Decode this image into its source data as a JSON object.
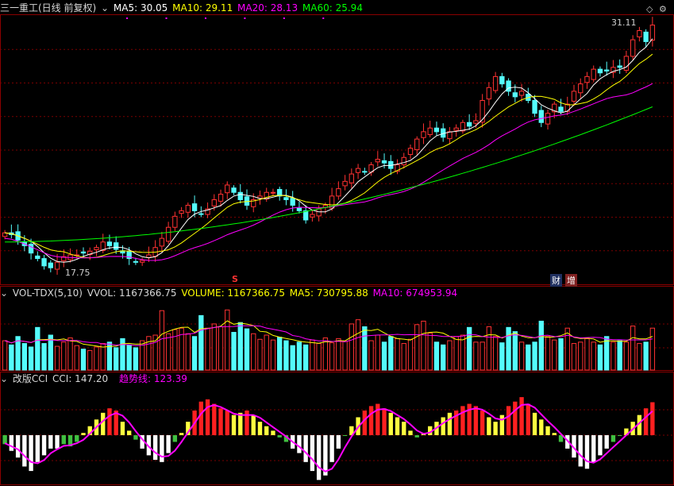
{
  "header": {
    "title": "三一重工(日线 前复权)",
    "ma5": "MA5: 30.05",
    "ma10": "MA10: 29.11",
    "ma20": "MA20: 28.13",
    "ma60": "MA60: 25.94"
  },
  "price_panel": {
    "high_label": "31.11",
    "low_label": "17.75",
    "markers": {
      "s": "S",
      "cai": "财",
      "zeng": "增"
    }
  },
  "volume_panel": {
    "name": "VOL-TDX(5,10)",
    "vvol": "VVOL: 1167366.75",
    "volume": "VOLUME: 1167366.75",
    "ma5": "MA5: 730795.88",
    "ma10": "MA10: 674953.94"
  },
  "cci_panel": {
    "name": "改版CCI",
    "cci": "CCI: 147.20",
    "trend": "趋势线: 123.39"
  },
  "colors": {
    "up": "#ff3232",
    "down": "#54fcfc",
    "grid": "#8b0000",
    "ma5": "#ffffff",
    "ma10": "#ffff00",
    "ma20": "#ff00ff",
    "ma60": "#00ff00"
  },
  "chart_data": [
    {
      "type": "candlestick",
      "title": "三一重工(日线 前复权)",
      "ylim": [
        17.0,
        31.6
      ],
      "close": [
        19.8,
        19.7,
        19.4,
        19.1,
        18.7,
        18.4,
        18.0,
        17.9,
        18.2,
        18.5,
        18.6,
        18.6,
        18.7,
        18.8,
        19.0,
        19.3,
        19.1,
        18.9,
        18.7,
        18.4,
        18.2,
        18.3,
        18.6,
        19.0,
        19.5,
        20.1,
        20.7,
        21.0,
        21.3,
        21.0,
        20.8,
        21.1,
        21.6,
        21.9,
        22.4,
        22.0,
        21.6,
        21.3,
        21.6,
        21.8,
        22.0,
        22.0,
        21.8,
        21.6,
        21.3,
        21.0,
        20.5,
        20.8,
        21.1,
        21.3,
        21.8,
        22.2,
        22.6,
        23.0,
        23.3,
        23.1,
        23.5,
        23.8,
        23.6,
        23.3,
        23.5,
        23.9,
        24.4,
        24.9,
        25.3,
        25.5,
        25.3,
        25.0,
        25.3,
        25.5,
        25.8,
        25.6,
        25.9,
        27.0,
        27.7,
        28.3,
        27.9,
        27.5,
        27.2,
        27.5,
        27.0,
        26.3,
        25.8,
        26.3,
        26.8,
        26.4,
        26.8,
        27.5,
        27.9,
        28.3,
        28.7,
        28.5,
        28.6,
        28.8,
        28.8,
        29.4,
        30.3,
        30.8,
        30.2,
        31.1
      ],
      "series": [
        {
          "name": "MA5",
          "last": 30.05
        },
        {
          "name": "MA10",
          "last": 29.11
        },
        {
          "name": "MA20",
          "last": 28.13
        },
        {
          "name": "MA60",
          "last": 25.94
        }
      ],
      "high_mark": 31.11,
      "low_mark": 17.75
    },
    {
      "type": "bar",
      "title": "VOL-TDX(5,10)",
      "values": [
        0.42,
        0.36,
        0.48,
        0.38,
        0.33,
        0.61,
        0.38,
        0.5,
        0.34,
        0.4,
        0.46,
        0.35,
        0.3,
        0.28,
        0.33,
        0.38,
        0.4,
        0.32,
        0.45,
        0.36,
        0.32,
        0.42,
        0.48,
        0.5,
        0.85,
        0.52,
        0.58,
        0.6,
        0.52,
        0.48,
        0.78,
        0.6,
        0.66,
        0.62,
        0.86,
        0.54,
        0.68,
        0.59,
        0.52,
        0.44,
        0.5,
        0.43,
        0.47,
        0.42,
        0.35,
        0.4,
        0.36,
        0.43,
        0.38,
        0.46,
        0.39,
        0.45,
        0.41,
        0.66,
        0.72,
        0.62,
        0.42,
        0.5,
        0.4,
        0.48,
        0.45,
        0.38,
        0.44,
        0.65,
        0.7,
        0.53,
        0.4,
        0.36,
        0.42,
        0.48,
        0.5,
        0.61,
        0.4,
        0.4,
        0.62,
        0.48,
        0.39,
        0.61,
        0.55,
        0.4,
        0.36,
        0.4,
        0.7,
        0.48,
        0.43,
        0.45,
        0.6,
        0.38,
        0.4,
        0.45,
        0.4,
        0.36,
        0.48,
        0.4,
        0.42,
        0.4,
        0.63,
        0.38,
        0.4,
        0.6
      ],
      "series": [
        {
          "name": "VOLUME",
          "last": 1167366.75
        },
        {
          "name": "MA5",
          "last": 730795.88
        },
        {
          "name": "MA10",
          "last": 674953.94
        }
      ]
    },
    {
      "type": "bar",
      "title": "改版CCI",
      "ylim": [
        -220,
        220
      ],
      "values": [
        -40,
        -70,
        -100,
        -140,
        -160,
        -120,
        -90,
        -60,
        -60,
        -40,
        -50,
        -30,
        10,
        40,
        70,
        100,
        120,
        110,
        60,
        20,
        -20,
        -60,
        -90,
        -110,
        -120,
        -80,
        -30,
        10,
        60,
        110,
        150,
        160,
        140,
        120,
        110,
        90,
        100,
        110,
        90,
        60,
        40,
        20,
        -10,
        -30,
        -60,
        -80,
        -120,
        -160,
        -200,
        -180,
        -120,
        -60,
        0,
        40,
        80,
        110,
        130,
        140,
        120,
        100,
        80,
        60,
        20,
        -10,
        10,
        40,
        60,
        80,
        100,
        110,
        130,
        140,
        130,
        110,
        80,
        60,
        90,
        130,
        150,
        170,
        140,
        100,
        70,
        40,
        10,
        -30,
        -60,
        -100,
        -140,
        -150,
        -120,
        -90,
        -60,
        -30,
        0,
        30,
        60,
        90,
        120,
        147.2
      ],
      "series": [
        {
          "name": "CCI",
          "last": 147.2
        },
        {
          "name": "趋势线",
          "last": 123.39
        }
      ]
    }
  ]
}
